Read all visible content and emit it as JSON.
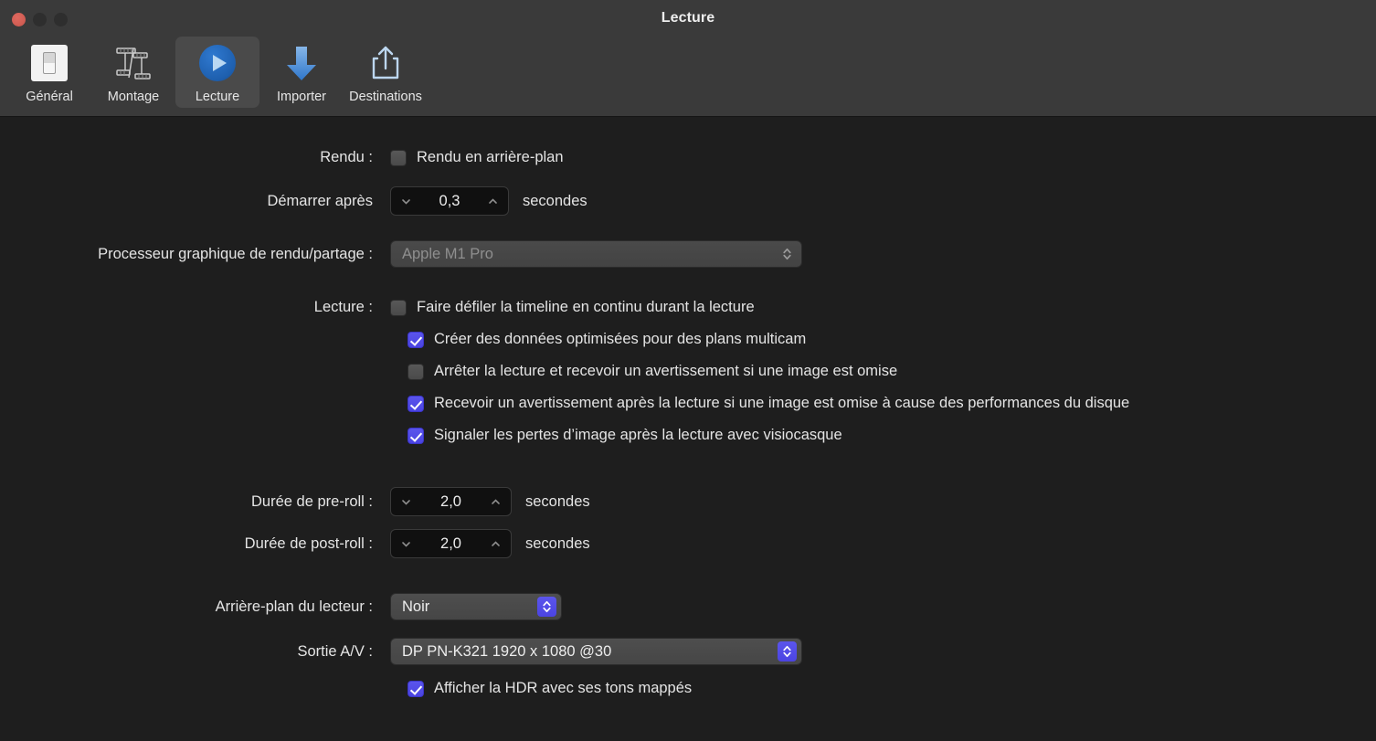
{
  "window": {
    "title": "Lecture",
    "traffic_lights": [
      "close",
      "minimize",
      "zoom"
    ]
  },
  "toolbar": {
    "tabs": [
      {
        "label": "Général",
        "icon": "toggle-switch-icon",
        "selected": false
      },
      {
        "label": "Montage",
        "icon": "film-strips-icon",
        "selected": false
      },
      {
        "label": "Lecture",
        "icon": "play-circle-icon",
        "selected": true
      },
      {
        "label": "Importer",
        "icon": "download-arrow-icon",
        "selected": false
      },
      {
        "label": "Destinations",
        "icon": "share-icon",
        "selected": false
      }
    ]
  },
  "settings": {
    "render": {
      "label": "Rendu :",
      "background_render": {
        "label": "Rendu en arrière-plan",
        "checked": false
      },
      "start_after": {
        "label": "Démarrer après",
        "value": "0,3",
        "unit": "secondes"
      }
    },
    "gpu": {
      "label": "Processeur graphique de rendu/partage :",
      "value": "Apple M1 Pro",
      "enabled": false
    },
    "playback": {
      "label": "Lecture :",
      "options": [
        {
          "label": "Faire défiler la timeline en continu durant la lecture",
          "checked": false
        },
        {
          "label": "Créer des données optimisées pour des plans multicam",
          "checked": true
        },
        {
          "label": "Arrêter la lecture et recevoir un avertissement si une image est omise",
          "checked": false
        },
        {
          "label": "Recevoir un avertissement après la lecture si une image est omise à cause des performances du disque",
          "checked": true
        },
        {
          "label": "Signaler les pertes d’image après la lecture avec visiocasque",
          "checked": true
        }
      ]
    },
    "pre_roll": {
      "label": "Durée de pre-roll :",
      "value": "2,0",
      "unit": "secondes"
    },
    "post_roll": {
      "label": "Durée de post-roll :",
      "value": "2,0",
      "unit": "secondes"
    },
    "player_background": {
      "label": "Arrière-plan du lecteur :",
      "value": "Noir"
    },
    "av_output": {
      "label": "Sortie A/V :",
      "value": "DP PN-K321 1920 x 1080 @30"
    },
    "hdr_tone_map": {
      "label": "Afficher la HDR avec ses tons mappés",
      "checked": true
    }
  },
  "colors": {
    "accent_checkbox": "#4b44e2",
    "toolbar_bg": "#3a3a3a",
    "content_bg": "#1e1e1e",
    "selected_tab_bg": "#4a4a4a"
  }
}
